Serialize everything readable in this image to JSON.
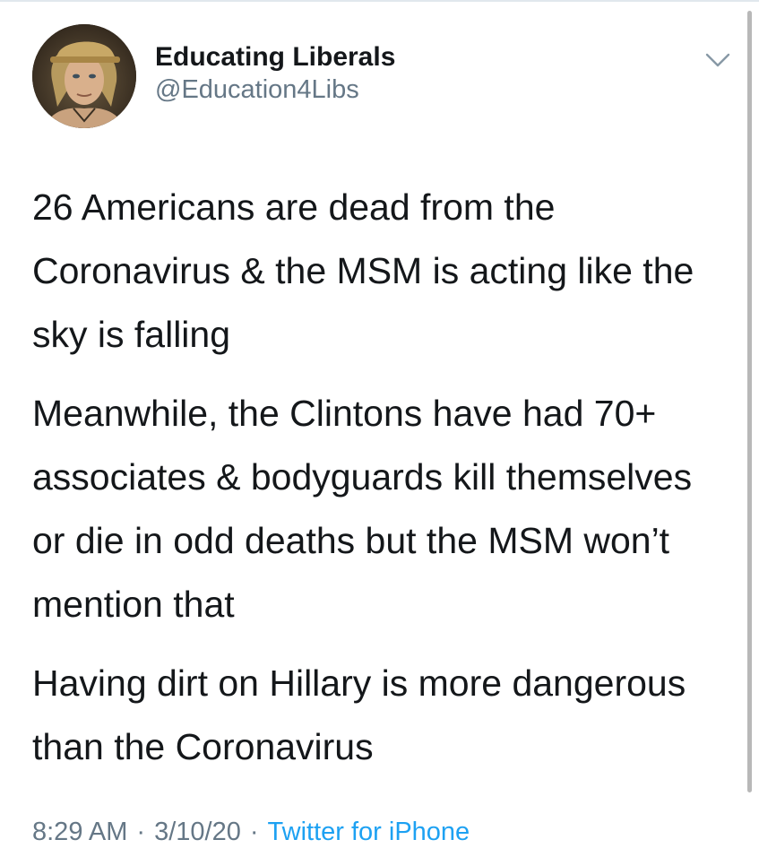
{
  "colors": {
    "text": "#14171a",
    "secondary": "#657786",
    "link": "#1da1f2"
  },
  "author": {
    "display_name": "Educating Liberals",
    "handle": "@Education4Libs",
    "avatar": "profile-photo",
    "menu_icon": "chevron-down-icon"
  },
  "tweet": {
    "paragraphs": [
      "26 Americans are dead from the Coronavirus & the MSM is acting like the sky is falling",
      "Meanwhile, the Clintons have had 70+ associates & bodyguards kill themselves or die in odd deaths but the MSM won’t mention that",
      "Having dirt on Hillary is more dangerous than the Coronavirus"
    ],
    "time": "8:29 AM",
    "date": "3/10/20",
    "separator": "·",
    "source": "Twitter for iPhone"
  }
}
